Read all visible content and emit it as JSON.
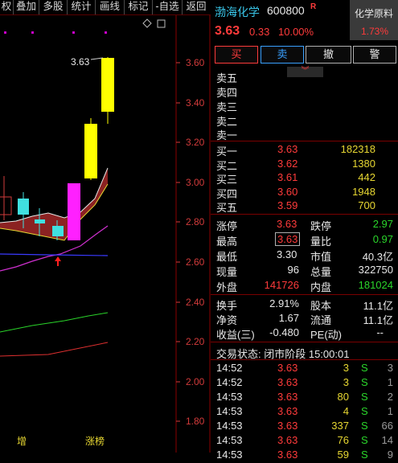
{
  "toolbar": {
    "items": [
      "权",
      "叠加",
      "多股",
      "统计",
      "画线",
      "标记",
      "-自选",
      "返回"
    ]
  },
  "chart": {
    "price_labels": [
      "3.60",
      "3.40",
      "3.20",
      "3.00",
      "2.80",
      "2.60",
      "2.40",
      "2.20",
      "2.00",
      "1.80"
    ],
    "high_label": "3.63",
    "bottom_tags": [
      "增",
      "涨榜"
    ]
  },
  "stock": {
    "name": "渤海化学",
    "code": "600800",
    "badge": "R",
    "price": "3.63",
    "change": "0.33",
    "pct": "10.00%",
    "sector": "化学原料",
    "sector_pct": "1.73%"
  },
  "buttons": {
    "buy": "买",
    "sell": "卖",
    "cancel": "撤",
    "alert": "警"
  },
  "sell_levels": [
    "卖五",
    "卖四",
    "卖三",
    "卖二",
    "卖一"
  ],
  "buy_levels": [
    {
      "label": "买一",
      "price": "3.63",
      "vol": "182318"
    },
    {
      "label": "买二",
      "price": "3.62",
      "vol": "1380"
    },
    {
      "label": "买三",
      "price": "3.61",
      "vol": "442"
    },
    {
      "label": "买四",
      "price": "3.60",
      "vol": "1948"
    },
    {
      "label": "买五",
      "price": "3.59",
      "vol": "700"
    }
  ],
  "stats": {
    "limit_up_l": "涨停",
    "limit_up": "3.63",
    "limit_down_l": "跌停",
    "limit_down": "2.97",
    "high_l": "最高",
    "high": "3.63",
    "vol_ratio_l": "量比",
    "vol_ratio": "0.97",
    "low_l": "最低",
    "low": "3.30",
    "mkt_cap_l": "市值",
    "mkt_cap": "40.3亿",
    "cur_vol_l": "现量",
    "cur_vol": "96",
    "total_vol_l": "总量",
    "total_vol": "322750",
    "outer_l": "外盘",
    "outer": "141726",
    "inner_l": "内盘",
    "inner": "181024",
    "turnover_l": "换手",
    "turnover": "2.91%",
    "capital_l": "股本",
    "capital": "11.1亿",
    "nav_l": "净资",
    "nav": "1.67",
    "float_l": "流通",
    "float": "11.1亿",
    "eps_l": "收益(三)",
    "eps": "-0.480",
    "pe_l": "PE(动)",
    "pe": "--"
  },
  "trade_status": "交易状态: 闭市阶段 15:00:01",
  "ticks": [
    {
      "time": "14:52",
      "price": "3.63",
      "vol": "3",
      "side": "S",
      "n": "3"
    },
    {
      "time": "14:52",
      "price": "3.63",
      "vol": "3",
      "side": "S",
      "n": "1"
    },
    {
      "time": "14:53",
      "price": "3.63",
      "vol": "80",
      "side": "S",
      "n": "2"
    },
    {
      "time": "14:53",
      "price": "3.63",
      "vol": "4",
      "side": "S",
      "n": "1"
    },
    {
      "time": "14:53",
      "price": "3.63",
      "vol": "337",
      "side": "S",
      "n": "66"
    },
    {
      "time": "14:53",
      "price": "3.63",
      "vol": "76",
      "side": "S",
      "n": "14"
    },
    {
      "time": "14:53",
      "price": "3.63",
      "vol": "59",
      "side": "S",
      "n": "9"
    }
  ]
}
